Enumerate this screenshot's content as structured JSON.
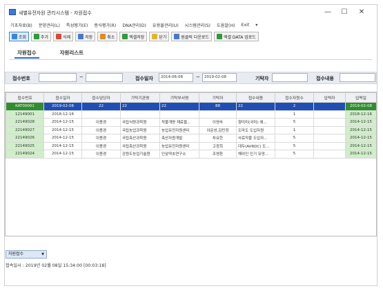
{
  "window": {
    "title": "새별유전자원 관리시스템 - 자원접수",
    "minimize": "—",
    "maximize": "☐",
    "close": "✕"
  },
  "menu": [
    "기초자료(B)",
    "분양관리(L)",
    "특성평가(E)",
    "증식평가(R)",
    "DNA관리(D)",
    "유용물관리(U)",
    "시스템관리(S)",
    "도움말(H)",
    "Exit",
    "▾"
  ],
  "toolbar": [
    {
      "label": "조회",
      "color": "#3a86d9"
    },
    {
      "label": "추가",
      "color": "#2e9b3a"
    },
    {
      "label": "삭제",
      "color": "#d24a3a"
    },
    {
      "label": "저장",
      "color": "#4a78c9"
    },
    {
      "label": "취소",
      "color": "#e08a2a"
    },
    {
      "label": "엑셀저장",
      "color": "#2e9b3a"
    },
    {
      "label": "닫기",
      "color": "#e3b52a"
    },
    {
      "label": "원클릭 다운로드",
      "color": "#4a78c9"
    },
    {
      "label": "엑셀 DATA 업로드",
      "color": "#2e9b3a"
    }
  ],
  "tabs": [
    {
      "label": "자원접수",
      "active": true
    },
    {
      "label": "자원리스트",
      "active": false
    }
  ],
  "search": {
    "receipt_no_label": "접수번호",
    "receipt_no_from": "",
    "receipt_no_to": "",
    "tilde": "~",
    "receipt_date_label": "접수일자",
    "date_from": "2014-06-08",
    "date_to": "2019-02-08",
    "donor_label": "기탁자",
    "donor_value": "",
    "content_label": "접수내용",
    "content_value": ""
  },
  "grid": {
    "columns": [
      "접수번호",
      "접수일자",
      "접수담당자",
      "기탁기관명",
      "기탁부서명",
      "기탁자",
      "접수내용",
      "접수자원수",
      "입력자",
      "입력일"
    ],
    "rows": [
      [
        "KAT00001",
        "2019-02-08",
        "22",
        "22",
        "22",
        "88",
        "22",
        "2",
        "",
        "2019-02-08"
      ],
      [
        "12149001",
        "2018-12-16",
        "",
        "",
        "",
        "",
        "",
        "1",
        "",
        "2018-12-16"
      ],
      [
        "22149028",
        "2014-12-15",
        "이용경",
        "국립식량과학원",
        "작물개량 재료을...",
        "이영숙",
        "향미미(국미) 에...",
        "5",
        "",
        "2014-12-15"
      ],
      [
        "22149027",
        "2014-12-15",
        "이용경",
        "국립농업과학원",
        "농업유전자원센터",
        "이문성,김민정",
        "도마도 도입자원",
        "1",
        "",
        "2014-12-15"
      ],
      [
        "22149026",
        "2014-12-15",
        "이용경",
        "국립축산과학원",
        "축산자원개발",
        "차요한",
        "사료작물 도입자...",
        "5",
        "",
        "2014-12-15"
      ],
      [
        "22149025",
        "2014-12-15",
        "이용경",
        "국립축산과학원",
        "농업유전자원센터",
        "고광희",
        "대두(AVRDC) 도...",
        "5",
        "",
        "2014-12-15"
      ],
      [
        "22149024",
        "2014-12-15",
        "이용경",
        "강원도농업기술원",
        "인삼약초연구소",
        "조영환",
        "해외인 인기 유망...",
        "5",
        "",
        "2014-12-15"
      ]
    ]
  },
  "footer": {
    "status_select": "자원접수",
    "status_text": "접속일시 : 2019년 02월 08일 15:34:00 [00:03:18]"
  },
  "colors": {
    "selected_row": "#1f4fb5",
    "receipt_no_cell": "#cfeec9",
    "search_panel": "#e8ecf2"
  }
}
